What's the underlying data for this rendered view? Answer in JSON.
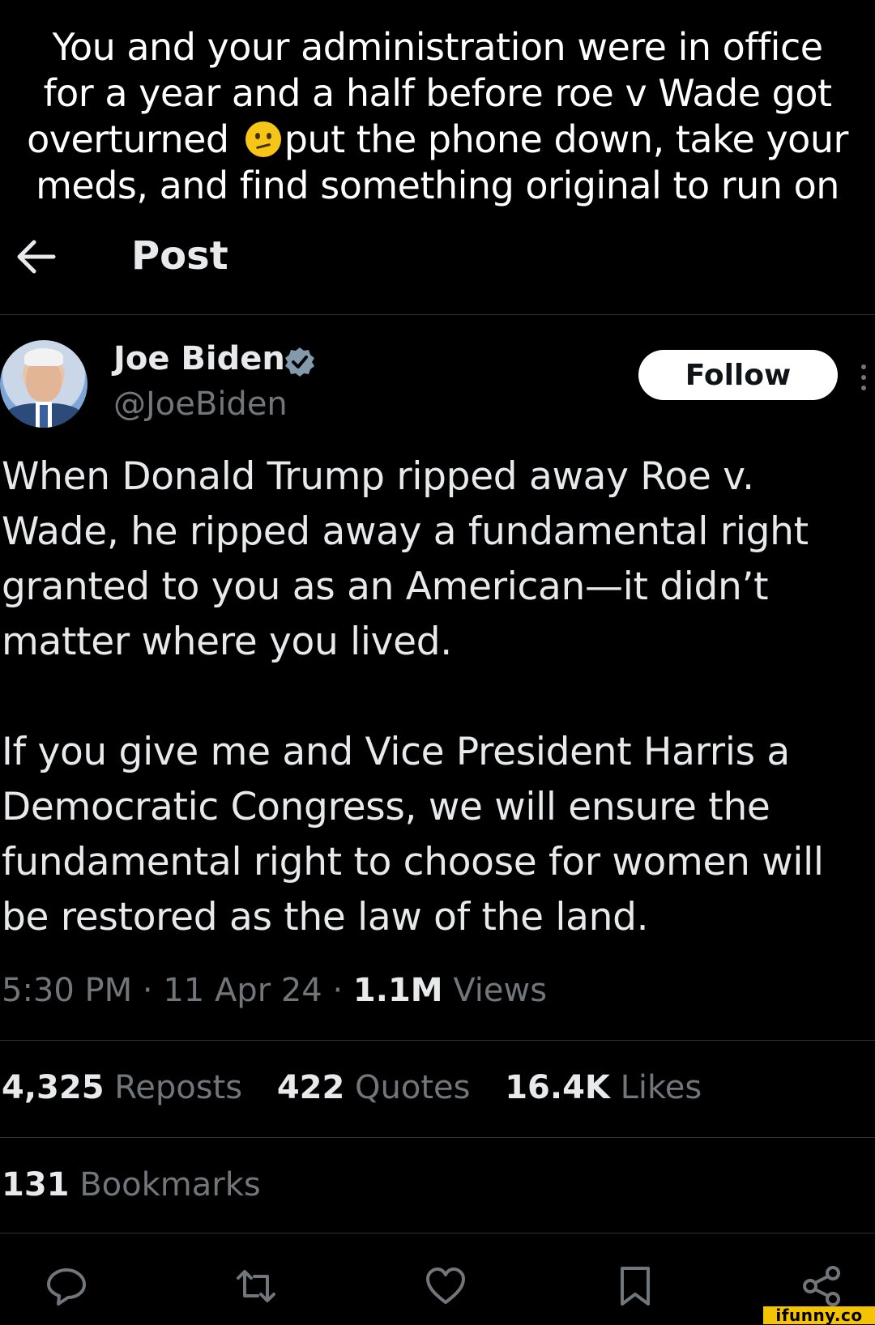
{
  "caption": {
    "line1": "You and your administration were in office",
    "line2": "for a year and a half before roe v Wade got",
    "line3_before_emoji": "overturned ",
    "line3_after_emoji": "put the phone down, take your",
    "line4": "meds, and find something original to run on"
  },
  "header": {
    "back_icon": "arrow-left-icon",
    "title": "Post"
  },
  "author": {
    "name": "Joe Biden",
    "handle": "@JoeBiden",
    "verified_icon": "verified-badge-icon"
  },
  "follow_label": "Follow",
  "tweet": {
    "paragraph1": "When Donald Trump ripped away Roe v.\nWade, he ripped away a fundamental right\ngranted to you as an American—it didn’t\nmatter where you lived.",
    "paragraph2": "If you give me and Vice President Harris a\nDemocratic Congress, we will ensure the\nfundamental right to choose for women will\nbe restored as the law of the land."
  },
  "meta": {
    "time": "5:30 PM",
    "date": "11 Apr 24",
    "views_count": "1.1M",
    "views_label": "Views"
  },
  "stats": {
    "reposts_count": "4,325",
    "reposts_label": "Reposts",
    "quotes_count": "422",
    "quotes_label": "Quotes",
    "likes_count": "16.4K",
    "likes_label": "Likes",
    "bookmarks_count": "131",
    "bookmarks_label": "Bookmarks"
  },
  "actions": [
    "reply-icon",
    "repost-icon",
    "like-icon",
    "bookmark-icon",
    "share-icon"
  ],
  "watermark": "ifunny.co",
  "colors": {
    "background": "#000000",
    "text": "#e7e9ea",
    "secondary": "#71767b",
    "verified": "#829aab",
    "divider": "#2f3336"
  }
}
